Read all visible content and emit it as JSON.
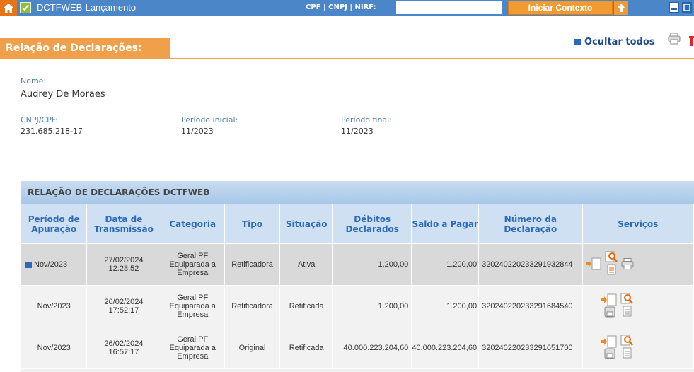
{
  "topbar": {
    "app_title": "DCTFWEB-Lançamento",
    "cpf_label": "CPF | CNPJ | NIRF:",
    "cpf_value": "",
    "context_button": "Iniciar Contexto"
  },
  "header": {
    "title": "Relação de Declarações:",
    "hide_all": "Ocultar todos"
  },
  "info": {
    "nome_label": "Nome:",
    "nome_value": "Audrey De Moraes",
    "cpf_label": "CNPJ/CPF:",
    "cpf_value": "231.685.218-17",
    "inicial_label": "Período inicial:",
    "inicial_value": "11/2023",
    "final_label": "Período final:",
    "final_value": "11/2023"
  },
  "table": {
    "title": "RELAÇÃO DE DECLARAÇÕES DCTFWEB",
    "headers": [
      "Período de Apuração",
      "Data de Transmissão",
      "Categoria",
      "Tipo",
      "Situação",
      "Débitos Declarados",
      "Saldo a Pagar",
      "Número da Declaração",
      "Serviços"
    ],
    "rows": [
      {
        "periodo": "Nov/2023",
        "data": "27/02/2024",
        "hora": "12:28:52",
        "categoria": "Geral PF Equiparada a Empresa",
        "tipo": "Retificadora",
        "situacao": "Ativa",
        "debitos": "1.200,00",
        "saldo": "1.200,00",
        "numero": "320240220233291932844"
      },
      {
        "periodo": "Nov/2023",
        "data": "26/02/2024",
        "hora": "17:52:17",
        "categoria": "Geral PF Equiparada a Empresa",
        "tipo": "Retificadora",
        "situacao": "Retificada",
        "debitos": "1.200,00",
        "saldo": "1.200,00",
        "numero": "320240220233291684540"
      },
      {
        "periodo": "Nov/2023",
        "data": "26/02/2024",
        "hora": "16:57:17",
        "categoria": "Geral PF Equiparada a Empresa",
        "tipo": "Original",
        "situacao": "Retificada",
        "debitos": "40.000.223.204,60",
        "saldo": "40.000.223.204,60",
        "numero": "320240220233291651700"
      }
    ]
  },
  "colors": {
    "topbar": "#4a86c8",
    "accent": "#f0a04a",
    "header_blue": "#2a6ab8"
  }
}
